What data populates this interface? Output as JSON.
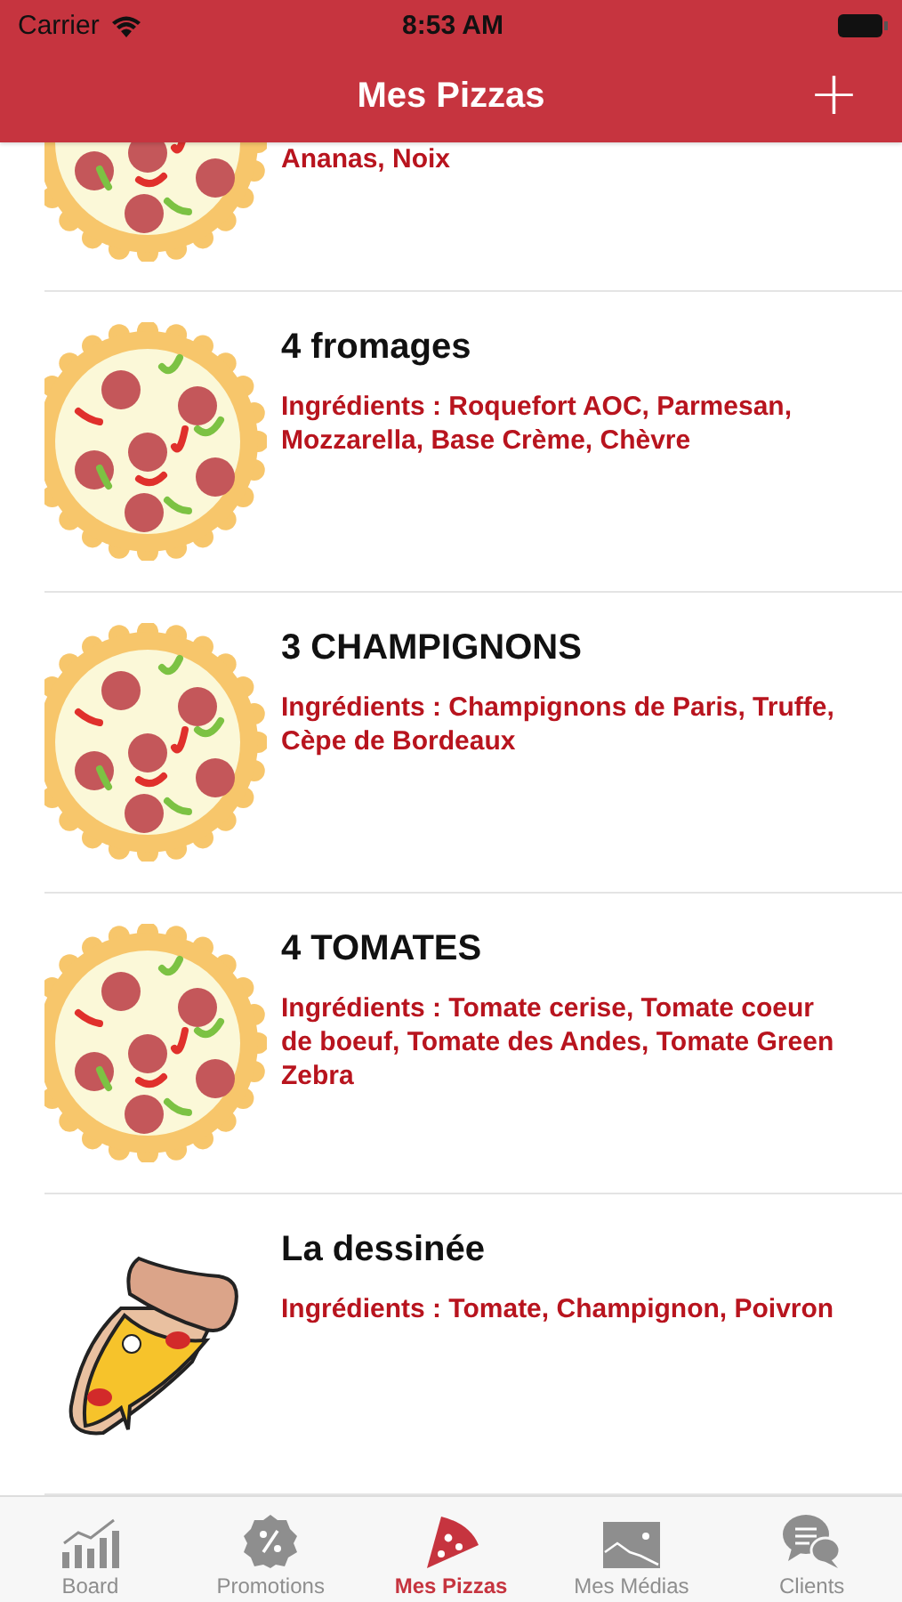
{
  "status_bar": {
    "carrier": "Carrier",
    "time": "8:53 AM"
  },
  "nav_bar": {
    "title": "Mes Pizzas",
    "action": "+"
  },
  "pizzas": [
    {
      "kind": "round",
      "ingredients": "Ananas, Noix"
    },
    {
      "kind": "round",
      "name": "4 fromages",
      "ingredients": "Ingrédients : Roquefort AOC, Parmesan, Mozzarella, Base Crème, Chèvre"
    },
    {
      "kind": "round",
      "name": "3 CHAMPIGNONS",
      "ingredients": "Ingrédients : Champignons de Paris, Truffe, Cèpe de Bordeaux"
    },
    {
      "kind": "round",
      "name": "4 TOMATES",
      "ingredients": "Ingrédients : Tomate cerise, Tomate coeur de boeuf, Tomate des Andes, Tomate Green Zebra"
    },
    {
      "kind": "slice",
      "name": "La dessinée",
      "ingredients": "Ingrédients : Tomate, Champignon, Poivron"
    }
  ],
  "tab_bar": [
    {
      "kind": "chart",
      "label": "Board",
      "selected": false
    },
    {
      "kind": "percent",
      "label": "Promotions",
      "selected": false
    },
    {
      "kind": "pizza",
      "label": "Mes Pizzas",
      "selected": true
    },
    {
      "kind": "image",
      "label": "Mes Médias",
      "selected": false
    },
    {
      "kind": "chat",
      "label": "Clients",
      "selected": false
    }
  ]
}
